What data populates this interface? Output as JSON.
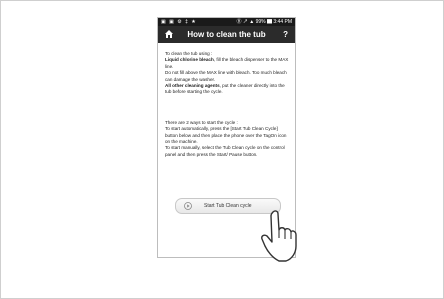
{
  "statusbar": {
    "left_icons": "▣ ▣ ⚙ ‡ ★",
    "right_text": "Ⓑ ↗ ▲ 99% ▇ 3:44 PM"
  },
  "header": {
    "title": "How to clean the tub",
    "help": "?"
  },
  "instructions": {
    "intro": "To clean the tub using :",
    "line1_bold": "Liquid chlorine bleach",
    "line1_rest": ", fill the bleach dispenser to the MAX line.",
    "line2": "Do not fill above the MAX line with bleach. Too much bleach can damage the washer.",
    "line3_bold": "All other cleaning agents",
    "line3_rest": ", put the cleaner directly into the tub before starting the cycle.",
    "ways_title": "There are 2 ways to start the cycle :",
    "auto": "To start automatically, press the [Start Tub Clean Cycle] button below and then place the phone over the TagOn icon on the machine.",
    "manual": "To start manually, select the Tub Clean cycle on the control panel and then press the Start/ Pause button."
  },
  "button": {
    "label": "Start Tub Clean cycle"
  },
  "colors": {
    "statusbar": "#1a1a1a",
    "titlebar": "#2b2b2b",
    "text": "#222222"
  }
}
